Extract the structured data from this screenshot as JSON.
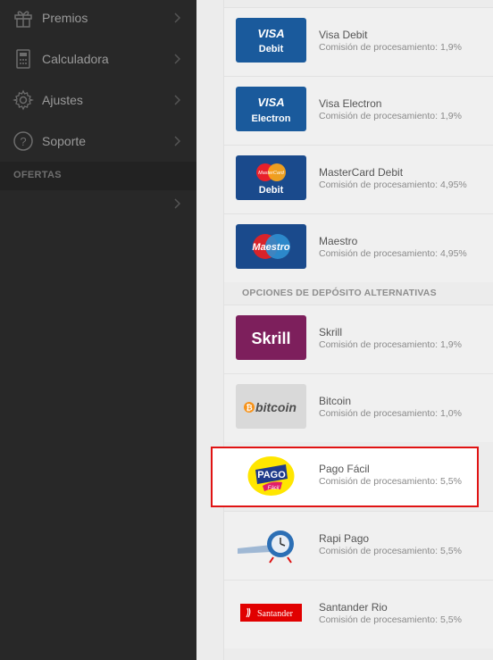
{
  "sidebar": {
    "items": [
      {
        "label": "Premios",
        "icon": "gift-icon"
      },
      {
        "label": "Calculadora",
        "icon": "calculator-icon"
      },
      {
        "label": "Ajustes",
        "icon": "gear-icon"
      },
      {
        "label": "Soporte",
        "icon": "help-icon"
      }
    ],
    "section_title": "OFERTAS"
  },
  "methods": [
    {
      "name": "Visa Debit",
      "fee": "Comisión de procesamiento: 1,9%",
      "logo_text": [
        "VISA",
        "Debit"
      ]
    },
    {
      "name": "Visa Electron",
      "fee": "Comisión de procesamiento: 1,9%",
      "logo_text": [
        "VISA",
        "Electron"
      ]
    },
    {
      "name": "MasterCard Debit",
      "fee": "Comisión de procesamiento: 4,95%",
      "logo_text": [
        "MasterCard",
        "Debit"
      ]
    },
    {
      "name": "Maestro",
      "fee": "Comisión de procesamiento: 4,95%",
      "logo_text": [
        "Maestro"
      ]
    }
  ],
  "alt_header": "OPCIONES DE DEPÓSITO ALTERNATIVAS",
  "alt_methods": [
    {
      "name": "Skrill",
      "fee": "Comisión de procesamiento: 1,9%",
      "logo_text": "Skrill"
    },
    {
      "name": "Bitcoin",
      "fee": "Comisión de procesamiento: 1,0%",
      "logo_text": "bitcoin"
    },
    {
      "name": "Pago Fácil",
      "fee": "Comisión de procesamiento: 5,5%",
      "logo_text": [
        "PAGO",
        "Fácil"
      ]
    },
    {
      "name": "Rapi Pago",
      "fee": "Comisión de procesamiento: 5,5%"
    },
    {
      "name": "Santander Rio",
      "fee": "Comisión de procesamiento: 5,5%",
      "logo_text": "Santander"
    }
  ],
  "colors": {
    "sidebar_bg": "#282828",
    "highlight_border": "#e01313",
    "visa_blue": "#1a5a9c",
    "skrill_purple": "#7d1f5c"
  }
}
